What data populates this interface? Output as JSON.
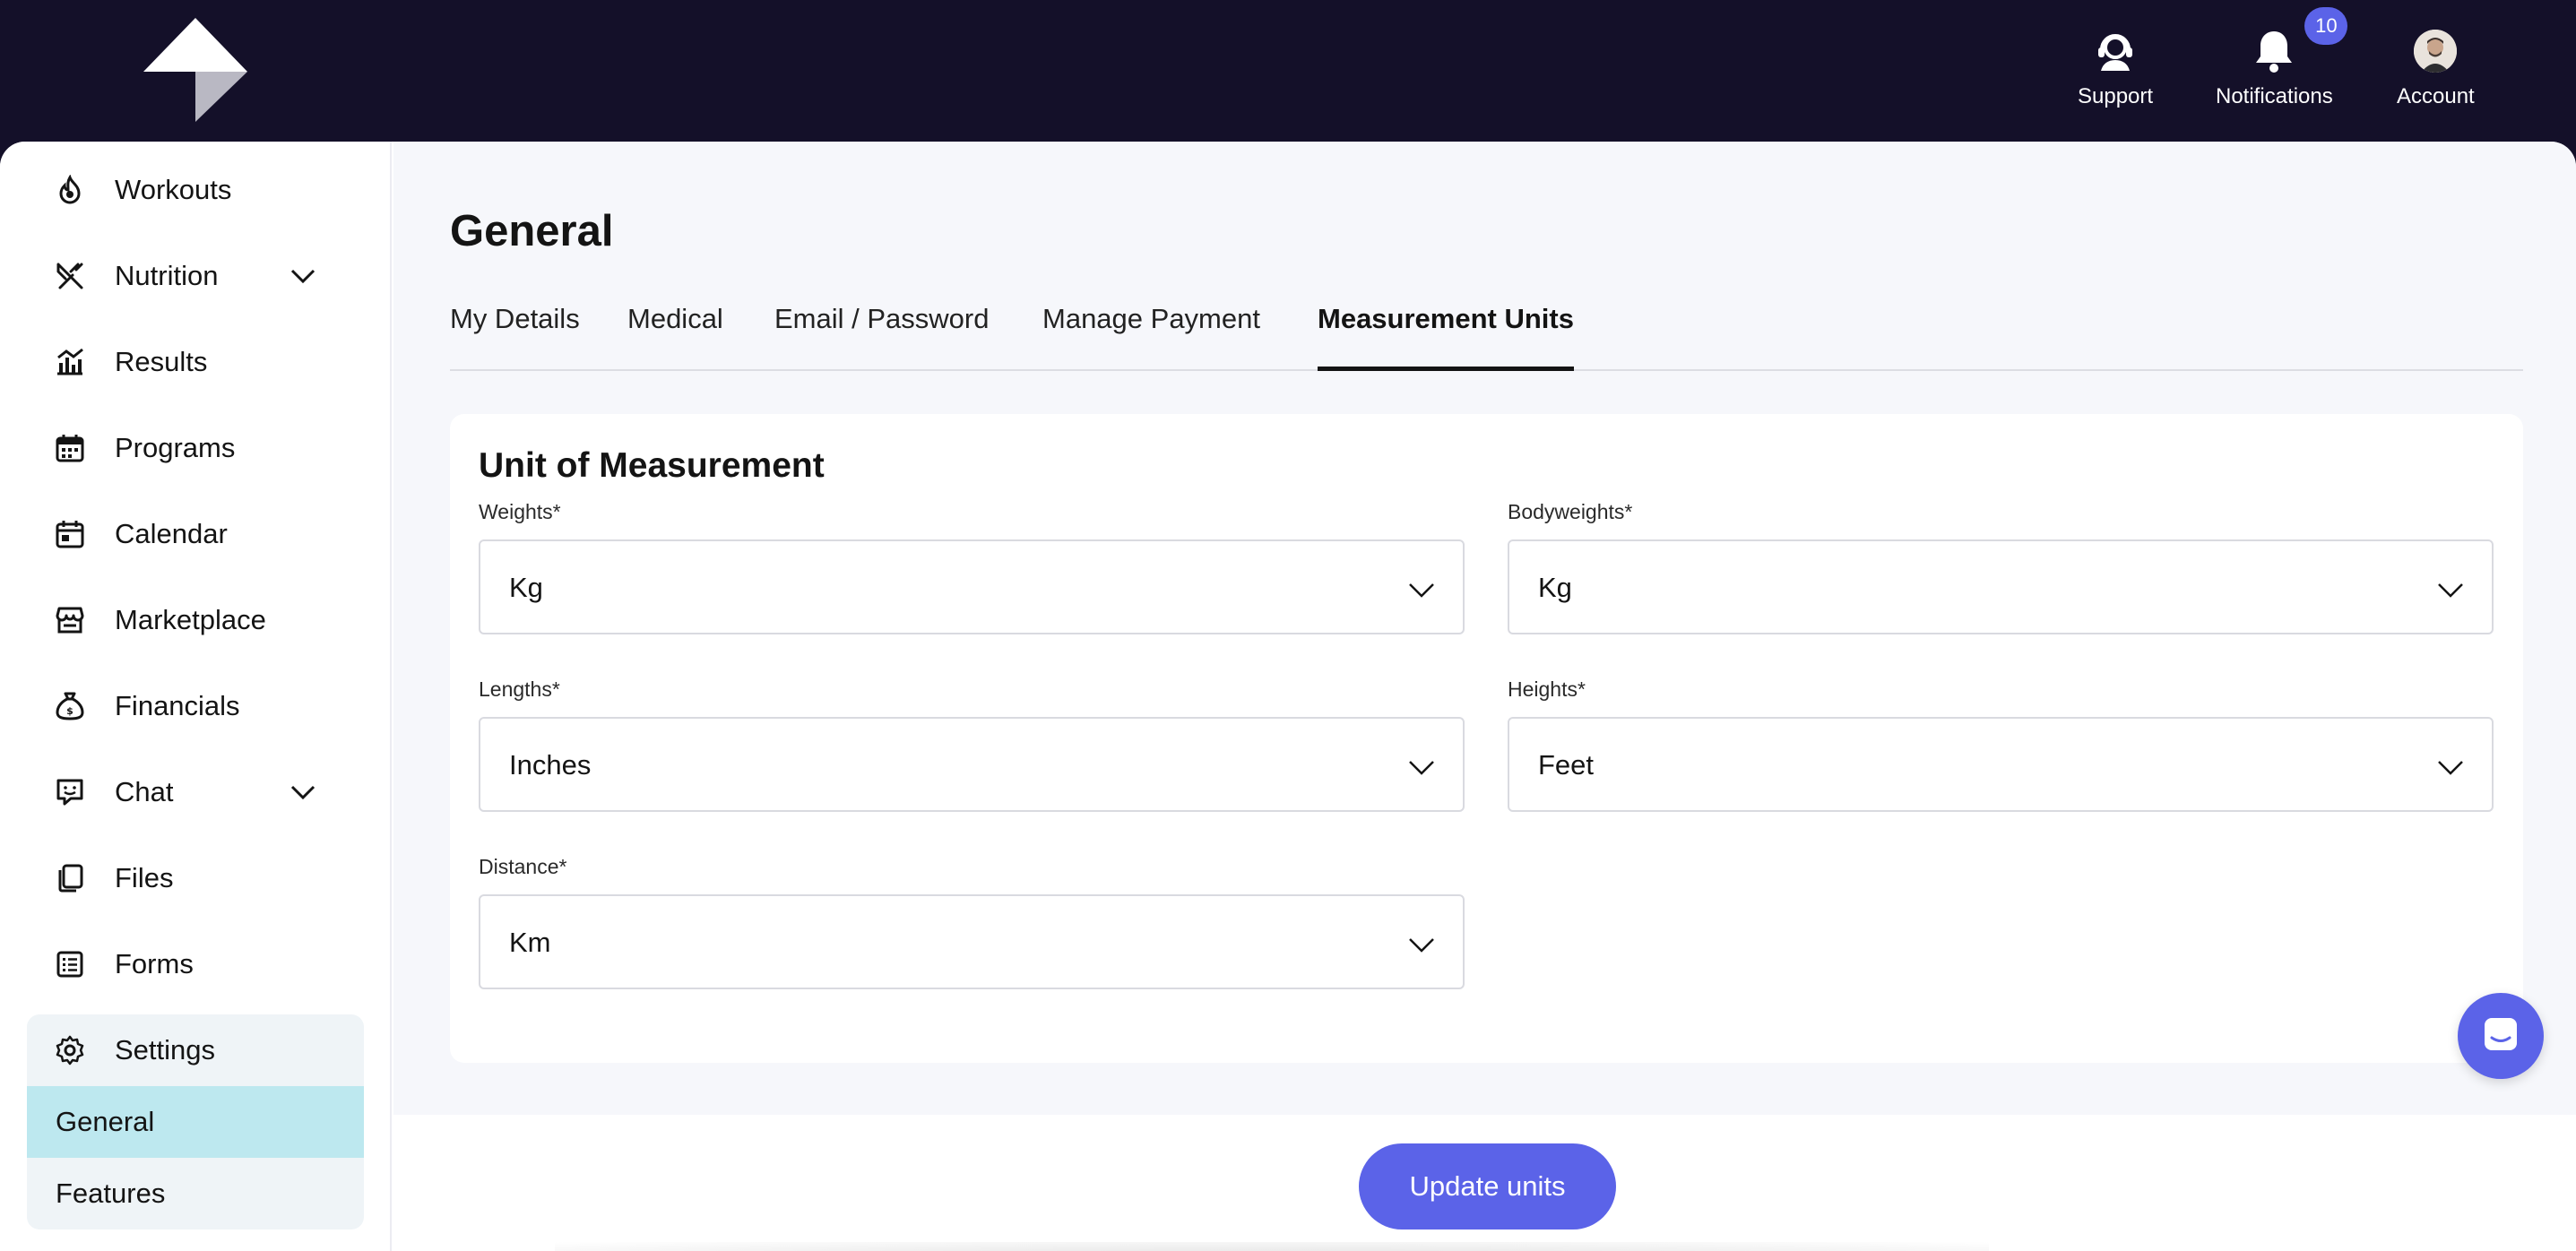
{
  "topbar": {
    "support_label": "Support",
    "notifications_label": "Notifications",
    "notifications_count": "10",
    "account_label": "Account"
  },
  "sidebar": {
    "items": [
      {
        "label": "Workouts",
        "icon": "flame-icon"
      },
      {
        "label": "Nutrition",
        "icon": "utensils-icon",
        "expandable": true
      },
      {
        "label": "Results",
        "icon": "chart-icon"
      },
      {
        "label": "Programs",
        "icon": "calendar-grid-icon"
      },
      {
        "label": "Calendar",
        "icon": "calendar-icon"
      },
      {
        "label": "Marketplace",
        "icon": "store-icon"
      },
      {
        "label": "Financials",
        "icon": "money-bag-icon"
      },
      {
        "label": "Chat",
        "icon": "chat-icon",
        "expandable": true
      },
      {
        "label": "Files",
        "icon": "files-icon"
      },
      {
        "label": "Forms",
        "icon": "forms-icon"
      }
    ],
    "settings": {
      "label": "Settings",
      "icon": "gear-icon",
      "sub_items": [
        "General",
        "Features"
      ],
      "active_sub_item": "General"
    }
  },
  "main": {
    "title": "General",
    "tabs": [
      "My Details",
      "Medical",
      "Email / Password",
      "Manage Payment",
      "Measurement Units"
    ],
    "active_tab": "Measurement Units",
    "card": {
      "title": "Unit of Measurement",
      "fields": {
        "weights": {
          "label": "Weights*",
          "value": "Kg"
        },
        "bodyweights": {
          "label": "Bodyweights*",
          "value": "Kg"
        },
        "lengths": {
          "label": "Lengths*",
          "value": "Inches"
        },
        "heights": {
          "label": "Heights*",
          "value": "Feet"
        },
        "distance": {
          "label": "Distance*",
          "value": "Km"
        }
      }
    },
    "update_button_label": "Update units"
  },
  "colors": {
    "topbar_bg": "#141029",
    "accent": "#5b63e8",
    "active_sub_item_bg": "#bde8ef",
    "settings_group_bg": "#eff4f7",
    "main_bg": "#f6f7fb"
  }
}
